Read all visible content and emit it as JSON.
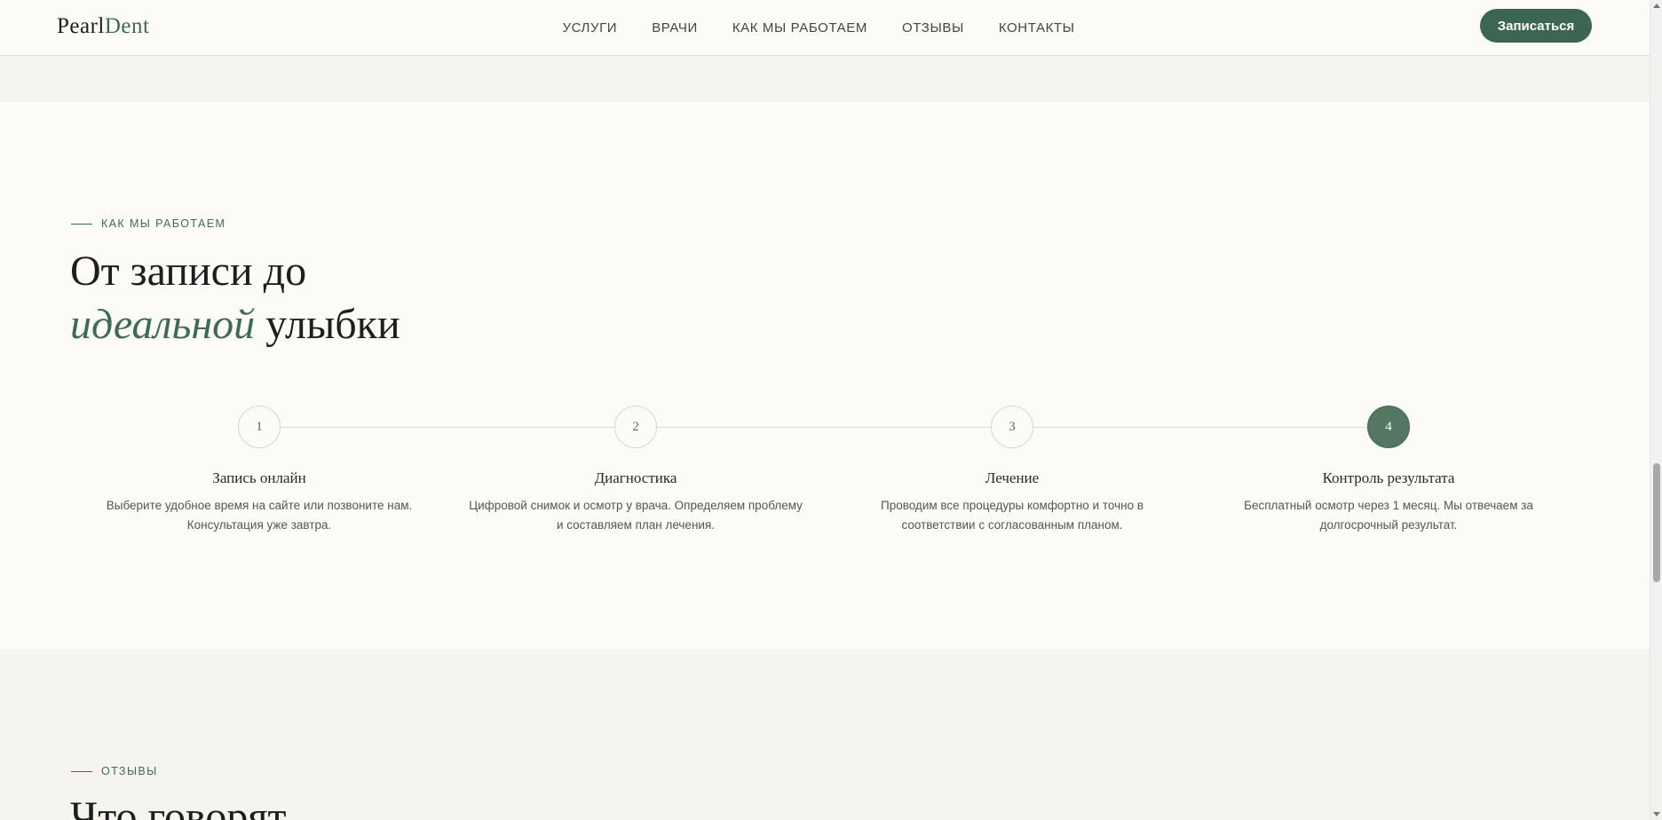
{
  "header": {
    "logo_part1": "Pearl",
    "logo_part2": "Dent",
    "nav": [
      "УСЛУГИ",
      "ВРАЧИ",
      "КАК МЫ РАБОТАЕМ",
      "ОТЗЫВЫ",
      "КОНТАКТЫ"
    ],
    "cta_label": "Записаться"
  },
  "process": {
    "eyebrow": "КАК МЫ РАБОТАЕМ",
    "title_line1": "От записи до",
    "title_em": "идеальной",
    "title_rest": " улыбки",
    "steps": [
      {
        "number": "1",
        "title": "Запись онлайн",
        "desc": "Выберите удобное время на сайте или позвоните нам. Консультация уже завтра."
      },
      {
        "number": "2",
        "title": "Диагностика",
        "desc": "Цифровой снимок и осмотр у врача. Определяем проблему и составляем план лечения."
      },
      {
        "number": "3",
        "title": "Лечение",
        "desc": "Проводим все процедуры комфортно и точно в соответствии с согласованным планом."
      },
      {
        "number": "4",
        "title": "Контроль результата",
        "desc": "Бесплатный осмотр через 1 месяц. Мы отвечаем за долгосрочный результат."
      }
    ]
  },
  "reviews": {
    "eyebrow": "ОТЗЫВЫ",
    "title_partial": "Что говорят"
  },
  "colors": {
    "accent": "#3d6652",
    "background": "#fcfbf7",
    "band": "#f6f4ee"
  }
}
